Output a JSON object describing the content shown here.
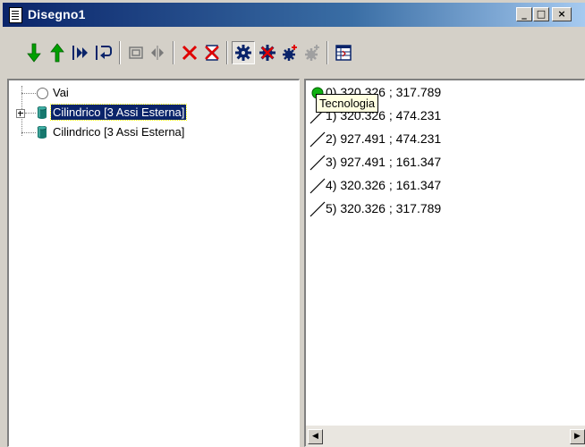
{
  "window": {
    "title": "Disegno1",
    "controls": {
      "minimize": "_",
      "maximize": "□",
      "close": "×"
    }
  },
  "toolbar": {
    "buttons": [
      {
        "icon": "arrow-down-green-icon"
      },
      {
        "icon": "arrow-up-green-icon"
      },
      {
        "icon": "skip-forward-icon"
      },
      {
        "icon": "return-icon"
      },
      {
        "icon": "frame-icon"
      },
      {
        "icon": "mirror-icon"
      },
      {
        "icon": "delete-red-x-icon"
      },
      {
        "icon": "hourglass-delete-icon"
      },
      {
        "icon": "gear-icon",
        "pressed": true
      },
      {
        "icon": "gear-delete-icon"
      },
      {
        "icon": "gear-add-icon"
      },
      {
        "icon": "gear-disabled-icon"
      },
      {
        "icon": "table-view-icon"
      }
    ]
  },
  "tree": {
    "items": [
      {
        "label": "Vai",
        "icon": "radio-icon",
        "selected": false,
        "expandable": false
      },
      {
        "label": "Cilindrico [3 Assi Esterna]",
        "icon": "cylinder-icon",
        "selected": true,
        "expandable": true
      },
      {
        "label": "Cilindrico [3 Assi Esterna]",
        "icon": "cylinder-icon",
        "selected": false,
        "expandable": false
      }
    ]
  },
  "tooltip": {
    "text": "Tecnologia"
  },
  "list": {
    "items": [
      {
        "text": "0) 320.326 ; 317.789",
        "icon": "start-point-icon"
      },
      {
        "text": "1) 320.326 ; 474.231",
        "icon": "line-segment-icon"
      },
      {
        "text": "2) 927.491 ; 474.231",
        "icon": "line-segment-icon"
      },
      {
        "text": "3) 927.491 ; 161.347",
        "icon": "line-segment-icon"
      },
      {
        "text": "4) 320.326 ; 161.347",
        "icon": "line-segment-icon"
      },
      {
        "text": "5) 320.326 ; 317.789",
        "icon": "line-segment-icon"
      }
    ]
  },
  "colors": {
    "title_bar_start": "#0a246a",
    "selection": "#0a246a",
    "tooltip_bg": "#ffffe1",
    "green_arrow": "#00a000",
    "red_x": "#e00000",
    "navy_gear": "#0a246a"
  }
}
